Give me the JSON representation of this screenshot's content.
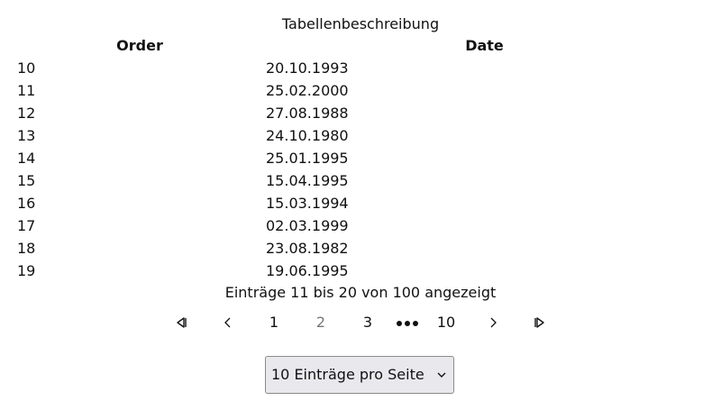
{
  "table": {
    "caption": "Tabellenbeschreibung",
    "headers": {
      "order": "Order",
      "date": "Date"
    },
    "rows": [
      {
        "order": "10",
        "date": "20.10.1993"
      },
      {
        "order": "11",
        "date": "25.02.2000"
      },
      {
        "order": "12",
        "date": "27.08.1988"
      },
      {
        "order": "13",
        "date": "24.10.1980"
      },
      {
        "order": "14",
        "date": "25.01.1995"
      },
      {
        "order": "15",
        "date": "15.04.1995"
      },
      {
        "order": "16",
        "date": "15.03.1994"
      },
      {
        "order": "17",
        "date": "02.03.1999"
      },
      {
        "order": "18",
        "date": "23.08.1982"
      },
      {
        "order": "19",
        "date": "19.06.1995"
      }
    ]
  },
  "info": "Einträge 11 bis 20 von 100 angezeigt",
  "pagination": {
    "first_icon": "first-page-icon",
    "prev_icon": "chevron-left-icon",
    "pages": [
      "1",
      "2",
      "3"
    ],
    "current_page": "2",
    "ellipsis_icon": "ellipsis-icon",
    "last_page": "10",
    "next_icon": "chevron-right-icon",
    "last_icon": "last-page-icon"
  },
  "page_size": {
    "selected": "10 Einträge pro Seite",
    "icon": "chevron-down-icon"
  }
}
